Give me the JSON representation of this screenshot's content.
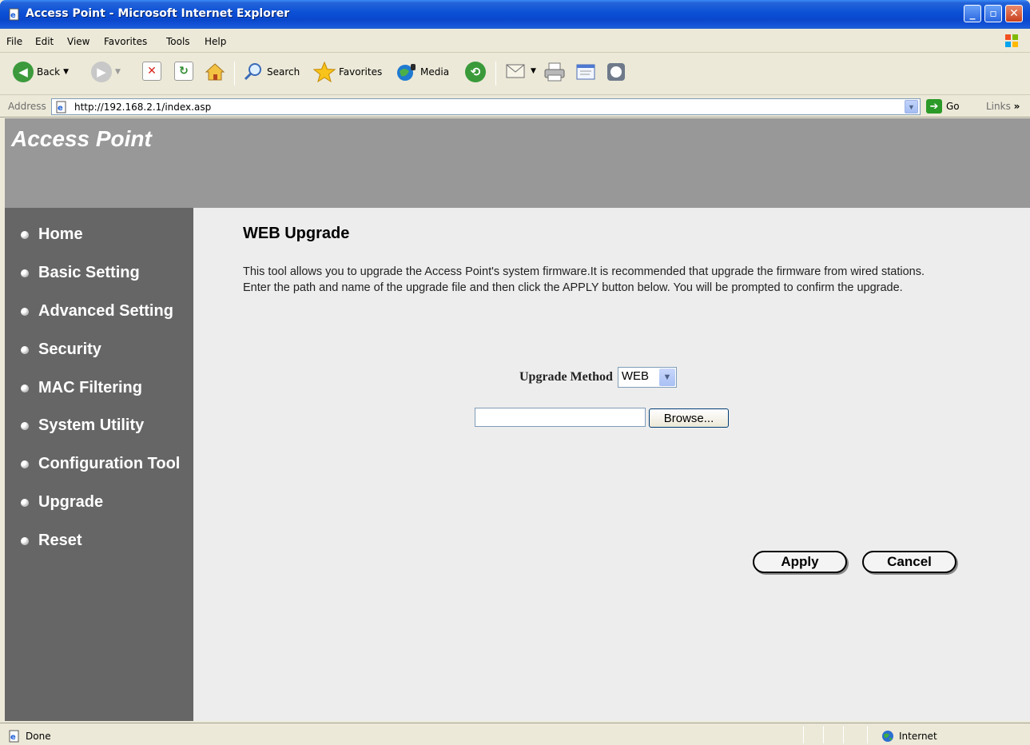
{
  "window": {
    "title": "Access Point - Microsoft Internet Explorer",
    "minimize": "_",
    "maximize": "▫",
    "close": "✕"
  },
  "menu": {
    "items": [
      "File",
      "Edit",
      "View",
      "Favorites",
      "Tools",
      "Help"
    ]
  },
  "toolbar": {
    "back_label": "Back",
    "search_label": "Search",
    "favorites_label": "Favorites",
    "media_label": "Media"
  },
  "address": {
    "label": "Address",
    "url": "http://192.168.2.1/index.asp",
    "go_label": "Go",
    "links_label": "Links"
  },
  "header": {
    "brand": "Access Point"
  },
  "sidebar": {
    "items": [
      {
        "label": "Home"
      },
      {
        "label": "Basic Setting"
      },
      {
        "label": "Advanced Setting"
      },
      {
        "label": "Security"
      },
      {
        "label": "MAC Filtering"
      },
      {
        "label": "System Utility"
      },
      {
        "label": "Configuration Tool"
      },
      {
        "label": "Upgrade"
      },
      {
        "label": "Reset"
      }
    ]
  },
  "main": {
    "title": "WEB Upgrade",
    "description_1": "This tool allows you to upgrade the Access Point's system firmware.It is recommended that upgrade the firmware from wired stations.",
    "description_2": "Enter the path and name of the upgrade file and then click the APPLY button below. You will be prompted to confirm the upgrade.",
    "upgrade_method_label": "Upgrade Method",
    "upgrade_method_value": "WEB",
    "file_path_value": "",
    "browse_label": "Browse...",
    "apply_label": "Apply",
    "cancel_label": "Cancel"
  },
  "status": {
    "text": "Done",
    "zone": "Internet"
  },
  "colors": {
    "banner": "#989898",
    "sidebar": "#666666",
    "content_bg": "#ededed",
    "titlebar": "#0b4fd6"
  },
  "icons": [
    "ie-page-icon",
    "xp-flag-icon",
    "back-arrow-icon",
    "forward-arrow-icon",
    "stop-icon",
    "refresh-icon",
    "home-icon",
    "search-icon",
    "favorites-star-icon",
    "media-icon",
    "history-icon",
    "mail-icon",
    "print-icon",
    "edit-icon",
    "messenger-icon",
    "go-arrow-icon",
    "globe-icon"
  ]
}
